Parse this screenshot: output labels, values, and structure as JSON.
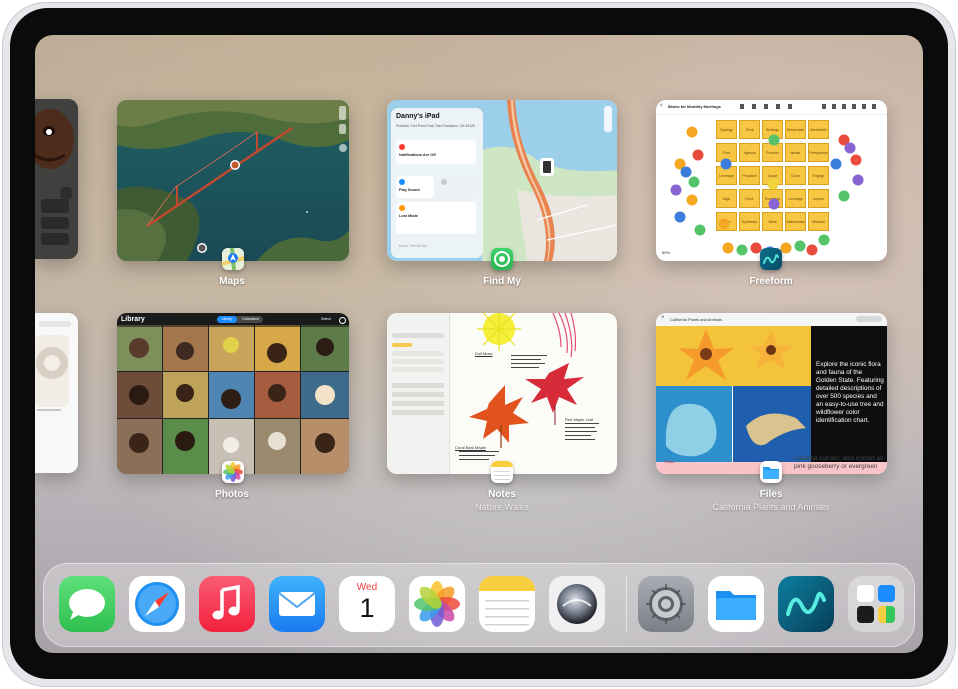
{
  "switcher": {
    "maps": {
      "title": "Maps"
    },
    "findmy": {
      "title": "Find My",
      "device_name": "Danny's iPad",
      "address": "Presidio, Fort Point Trail, San Francisco, CA 94129",
      "notifications": "Notifications Are Off",
      "play_sound": "Play Sound",
      "lost_mode": "Lost Mode",
      "erase": "Erase This Device"
    },
    "freeform": {
      "title": "Freeform",
      "board_title": "Bistro for Monthly Meetings",
      "zoom": "89%"
    },
    "photos": {
      "title": "Photos",
      "header": "Library",
      "tab_library": "Library",
      "tab_collections": "Collections",
      "select": "Select"
    },
    "notes": {
      "title": "Notes",
      "subtitle": "Nature Walks",
      "note_1": "Dull Moss",
      "note_2": "Coral Bark Maple",
      "note_3": "Red Maple Leaf"
    },
    "files": {
      "title": "Files",
      "subtitle": "California Plants and Animals",
      "doc_header": "California Plants and Animals",
      "description": "Explore the iconic flora and fauna of the Golden State. Featuring detailed descriptions of over 500 species and an easy-to-use tree and wildflower color identification chart.",
      "photo_caption": "Photo",
      "lower_text": "Catalina currant, also known as pink gooseberry or evergreen"
    }
  },
  "dock": {
    "calendar_day": "Wed",
    "calendar_date": "1",
    "apps": [
      "messages-icon",
      "safari-icon",
      "music-icon",
      "mail-icon",
      "calendar-icon",
      "photos-icon",
      "notes-icon",
      "siri-icon",
      "settings-icon",
      "files-icon",
      "freeform-icon",
      "app-library-icon"
    ]
  },
  "colors": {
    "accent_blue": "#1a8cff",
    "messages_green": "#34c759",
    "music_red": "#fa2d48",
    "freeform_sticky": "#f7c743",
    "files_blue": "#1d9bf0"
  }
}
